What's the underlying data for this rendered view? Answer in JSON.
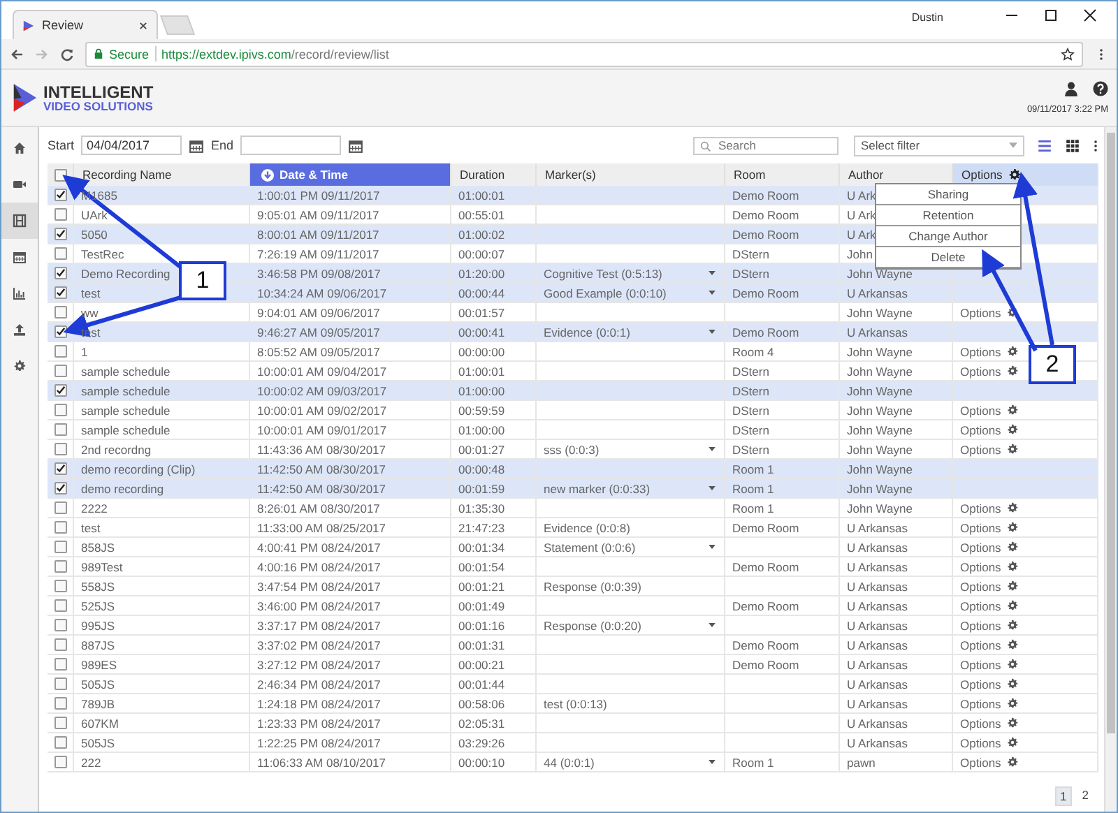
{
  "browser": {
    "tab_title": "Review",
    "user": "Dustin",
    "secure_label": "Secure",
    "url_host": "https://extdev.ipivs.com",
    "url_path": "/record/review/list"
  },
  "header": {
    "logo_line1": "INTELLIGENT",
    "logo_line2": "VIDEO SOLUTIONS",
    "datetime": "09/11/2017 3:22 PM"
  },
  "sidebar": {
    "items": [
      {
        "selected": false
      },
      {
        "selected": false
      },
      {
        "selected": true
      },
      {
        "selected": false
      },
      {
        "selected": false
      },
      {
        "selected": false
      },
      {
        "selected": false
      }
    ]
  },
  "filters": {
    "start_label": "Start",
    "start_value": "04/04/2017",
    "end_label": "End",
    "search_placeholder": "Search",
    "filter_placeholder": "Select filter"
  },
  "table": {
    "columns": [
      {
        "label": "Recording Name",
        "sorted": false
      },
      {
        "label": "Date & Time",
        "sorted": true
      },
      {
        "label": "Duration",
        "sorted": false
      },
      {
        "label": "Marker(s)",
        "sorted": false
      },
      {
        "label": "Room",
        "sorted": false
      },
      {
        "label": "Author",
        "sorted": false
      },
      {
        "label": "Options",
        "sorted": false
      }
    ],
    "select_all_checked": false,
    "rows": [
      {
        "selected": true,
        "name": "M1685",
        "date": "1:00:01 PM 09/11/2017",
        "duration": "01:00:01",
        "marker": "",
        "marker_menu": false,
        "room": "Demo Room",
        "author": "U Ark"
      },
      {
        "selected": false,
        "name": "UArk",
        "date": "9:05:01 AM 09/11/2017",
        "duration": "00:55:01",
        "marker": "",
        "marker_menu": false,
        "room": "Demo Room",
        "author": "U Ark"
      },
      {
        "selected": true,
        "name": "5050",
        "date": "8:00:01 AM 09/11/2017",
        "duration": "01:00:02",
        "marker": "",
        "marker_menu": false,
        "room": "Demo Room",
        "author": "U Ark"
      },
      {
        "selected": false,
        "name": "TestRec",
        "date": "7:26:19 AM 09/11/2017",
        "duration": "00:00:07",
        "marker": "",
        "marker_menu": false,
        "room": "DStern",
        "author": "John"
      },
      {
        "selected": true,
        "name": "Demo Recording",
        "date": "3:46:58 PM 09/08/2017",
        "duration": "01:20:00",
        "marker": "Cognitive Test (0:5:13)",
        "marker_menu": true,
        "room": "DStern",
        "author": "John Wayne"
      },
      {
        "selected": true,
        "name": "test",
        "date": "10:34:24 AM 09/06/2017",
        "duration": "00:00:44",
        "marker": "Good Example (0:0:10)",
        "marker_menu": true,
        "room": "Demo Room",
        "author": "U Arkansas"
      },
      {
        "selected": false,
        "name": "ww",
        "date": "9:04:01 AM 09/06/2017",
        "duration": "00:01:57",
        "marker": "",
        "marker_menu": false,
        "room": "",
        "author": "John Wayne",
        "options_label": "Options"
      },
      {
        "selected": true,
        "name": "test",
        "date": "9:46:27 AM 09/05/2017",
        "duration": "00:00:41",
        "marker": "Evidence (0:0:1)",
        "marker_menu": true,
        "room": "Demo Room",
        "author": "U Arkansas"
      },
      {
        "selected": false,
        "name": "1",
        "date": "8:05:52 AM 09/05/2017",
        "duration": "00:00:00",
        "marker": "",
        "marker_menu": false,
        "room": "Room 4",
        "author": "John Wayne",
        "options_label": "Options"
      },
      {
        "selected": false,
        "name": "sample schedule",
        "date": "10:00:01 AM 09/04/2017",
        "duration": "01:00:01",
        "marker": "",
        "marker_menu": false,
        "room": "DStern",
        "author": "John Wayne",
        "options_label": "Options"
      },
      {
        "selected": true,
        "name": "sample schedule",
        "date": "10:00:02 AM 09/03/2017",
        "duration": "01:00:00",
        "marker": "",
        "marker_menu": false,
        "room": "DStern",
        "author": "John Wayne"
      },
      {
        "selected": false,
        "name": "sample schedule",
        "date": "10:00:01 AM 09/02/2017",
        "duration": "00:59:59",
        "marker": "",
        "marker_menu": false,
        "room": "DStern",
        "author": "John Wayne",
        "options_label": "Options"
      },
      {
        "selected": false,
        "name": "sample schedule",
        "date": "10:00:01 AM 09/01/2017",
        "duration": "01:00:00",
        "marker": "",
        "marker_menu": false,
        "room": "DStern",
        "author": "John Wayne",
        "options_label": "Options"
      },
      {
        "selected": false,
        "name": "2nd recordng",
        "date": "11:43:36 AM 08/30/2017",
        "duration": "00:01:27",
        "marker": "sss (0:0:3)",
        "marker_menu": true,
        "room": "DStern",
        "author": "John Wayne",
        "options_label": "Options"
      },
      {
        "selected": true,
        "name": "demo recording (Clip)",
        "date": "11:42:50 AM 08/30/2017",
        "duration": "00:00:48",
        "marker": "",
        "marker_menu": false,
        "room": "Room 1",
        "author": "John Wayne"
      },
      {
        "selected": true,
        "name": "demo recording",
        "date": "11:42:50 AM 08/30/2017",
        "duration": "00:01:59",
        "marker": "new marker (0:0:33)",
        "marker_menu": true,
        "room": "Room 1",
        "author": "John Wayne"
      },
      {
        "selected": false,
        "name": "2222",
        "date": "8:26:01 AM 08/30/2017",
        "duration": "01:35:30",
        "marker": "",
        "marker_menu": false,
        "room": "Room 1",
        "author": "John Wayne",
        "options_label": "Options"
      },
      {
        "selected": false,
        "name": "test",
        "date": "11:33:00 AM 08/25/2017",
        "duration": "21:47:23",
        "marker": "Evidence (0:0:8)",
        "marker_menu": false,
        "room": "Demo Room",
        "author": "U Arkansas",
        "options_label": "Options"
      },
      {
        "selected": false,
        "name": "858JS",
        "date": "4:00:41 PM 08/24/2017",
        "duration": "00:01:34",
        "marker": "Statement (0:0:6)",
        "marker_menu": true,
        "room": "",
        "author": "U Arkansas",
        "options_label": "Options"
      },
      {
        "selected": false,
        "name": "989Test",
        "date": "4:00:16 PM 08/24/2017",
        "duration": "00:01:54",
        "marker": "",
        "marker_menu": false,
        "room": "Demo Room",
        "author": "U Arkansas",
        "options_label": "Options"
      },
      {
        "selected": false,
        "name": "558JS",
        "date": "3:47:54 PM 08/24/2017",
        "duration": "00:01:21",
        "marker": "Response (0:0:39)",
        "marker_menu": false,
        "room": "",
        "author": "U Arkansas",
        "options_label": "Options"
      },
      {
        "selected": false,
        "name": "525JS",
        "date": "3:46:00 PM 08/24/2017",
        "duration": "00:01:49",
        "marker": "",
        "marker_menu": false,
        "room": "Demo Room",
        "author": "U Arkansas",
        "options_label": "Options"
      },
      {
        "selected": false,
        "name": "995JS",
        "date": "3:37:17 PM 08/24/2017",
        "duration": "00:01:16",
        "marker": "Response (0:0:20)",
        "marker_menu": true,
        "room": "",
        "author": "U Arkansas",
        "options_label": "Options"
      },
      {
        "selected": false,
        "name": "887JS",
        "date": "3:37:02 PM 08/24/2017",
        "duration": "00:01:31",
        "marker": "",
        "marker_menu": false,
        "room": "Demo Room",
        "author": "U Arkansas",
        "options_label": "Options"
      },
      {
        "selected": false,
        "name": "989ES",
        "date": "3:27:12 PM 08/24/2017",
        "duration": "00:00:21",
        "marker": "",
        "marker_menu": false,
        "room": "Demo Room",
        "author": "U Arkansas",
        "options_label": "Options"
      },
      {
        "selected": false,
        "name": "505JS",
        "date": "2:46:34 PM 08/24/2017",
        "duration": "00:01:44",
        "marker": "",
        "marker_menu": false,
        "room": "",
        "author": "U Arkansas",
        "options_label": "Options"
      },
      {
        "selected": false,
        "name": "789JB",
        "date": "1:24:18 PM 08/24/2017",
        "duration": "00:58:06",
        "marker": "test (0:0:13)",
        "marker_menu": false,
        "room": "",
        "author": "U Arkansas",
        "options_label": "Options"
      },
      {
        "selected": false,
        "name": "607KM",
        "date": "1:23:33 PM 08/24/2017",
        "duration": "02:05:31",
        "marker": "",
        "marker_menu": false,
        "room": "",
        "author": "U Arkansas",
        "options_label": "Options"
      },
      {
        "selected": false,
        "name": "505JS",
        "date": "1:22:25 PM 08/24/2017",
        "duration": "03:29:26",
        "marker": "",
        "marker_menu": false,
        "room": "",
        "author": "U Arkansas",
        "options_label": "Options"
      },
      {
        "selected": false,
        "name": "222",
        "date": "11:06:33 AM 08/10/2017",
        "duration": "00:00:10",
        "marker": "44 (0:0:1)",
        "marker_menu": true,
        "room": "Room 1",
        "author": "pawn",
        "options_label": "Options"
      }
    ]
  },
  "options_menu": {
    "items": [
      "Sharing",
      "Retention",
      "Change Author",
      "Delete"
    ]
  },
  "pagination": [
    {
      "label": "1",
      "selected": true
    },
    {
      "label": "2",
      "selected": false
    }
  ],
  "callouts": [
    {
      "label": "1"
    },
    {
      "label": "2"
    }
  ]
}
